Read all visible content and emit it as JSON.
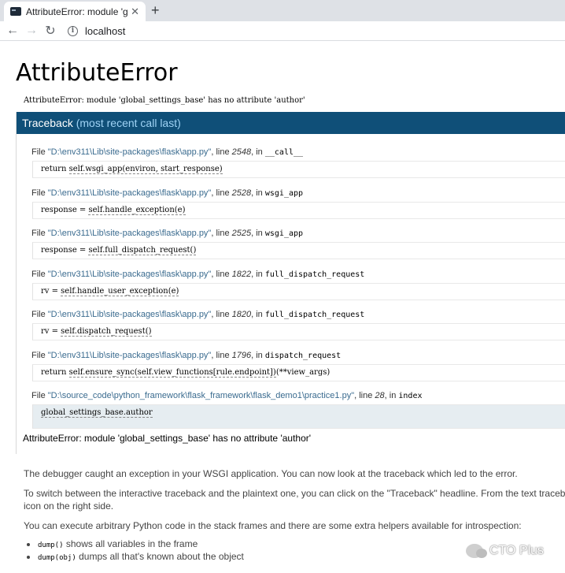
{
  "browser": {
    "tab_title": "AttributeError: module 'global_",
    "tab_close": "✕",
    "new_tab": "+",
    "back": "←",
    "forward": "→",
    "reload": "↻",
    "address": "localhost",
    "info": "i"
  },
  "error": {
    "title": "AttributeError",
    "message": "AttributeError: module 'global_settings_base' has no attribute 'author'"
  },
  "traceback": {
    "header_main": "Traceback",
    "header_sub": "(most recent call last)",
    "frames": [
      {
        "prefix": "File ",
        "file": "\"D:\\env311\\Lib\\site-packages\\flask\\app.py\"",
        "mid": ", line ",
        "line": "2548",
        "in": ", in ",
        "func": "__call__",
        "code_pre": "return ",
        "code_call": "self.wsgi_app(environ, start_response)",
        "code_post": ""
      },
      {
        "prefix": "File ",
        "file": "\"D:\\env311\\Lib\\site-packages\\flask\\app.py\"",
        "mid": ", line ",
        "line": "2528",
        "in": ", in ",
        "func": "wsgi_app",
        "code_pre": "response = ",
        "code_call": "self.handle_exception(e)",
        "code_post": ""
      },
      {
        "prefix": "File ",
        "file": "\"D:\\env311\\Lib\\site-packages\\flask\\app.py\"",
        "mid": ", line ",
        "line": "2525",
        "in": ", in ",
        "func": "wsgi_app",
        "code_pre": "response = ",
        "code_call": "self.full_dispatch_request()",
        "code_post": ""
      },
      {
        "prefix": "File ",
        "file": "\"D:\\env311\\Lib\\site-packages\\flask\\app.py\"",
        "mid": ", line ",
        "line": "1822",
        "in": ", in ",
        "func": "full_dispatch_request",
        "code_pre": "rv = ",
        "code_call": "self.handle_user_exception(e)",
        "code_post": ""
      },
      {
        "prefix": "File ",
        "file": "\"D:\\env311\\Lib\\site-packages\\flask\\app.py\"",
        "mid": ", line ",
        "line": "1820",
        "in": ", in ",
        "func": "full_dispatch_request",
        "code_pre": "rv = ",
        "code_call": "self.dispatch_request()",
        "code_post": ""
      },
      {
        "prefix": "File ",
        "file": "\"D:\\env311\\Lib\\site-packages\\flask\\app.py\"",
        "mid": ", line ",
        "line": "1796",
        "in": ", in ",
        "func": "dispatch_request",
        "code_pre": "return ",
        "code_call": "self.ensure_sync(self.view_functions[rule.endpoint])",
        "code_post": "(**view_args)"
      },
      {
        "prefix": "File ",
        "file": "\"D:\\source_code\\python_framework\\flask_framework\\flask_demo1\\practice1.py\"",
        "mid": ", line ",
        "line": "28",
        "in": ", in ",
        "func": "index",
        "code_pre": "",
        "code_call": "global_settings_base.author",
        "code_post": ""
      }
    ],
    "exception_line": "AttributeError: module 'global_settings_base' has no attribute 'author'"
  },
  "explanation": {
    "p1": "The debugger caught an exception in your WSGI application. You can now look at the traceback which led to the error.",
    "p2": "To switch between the interactive traceback and the plaintext one, you can click on the \"Traceback\" headline. From the text traceback you can also create a paste of it. For code execution mouse-over the frame you want to debug and click on the console icon on the right side.",
    "p2_visible_line1": "To switch between the interactive traceback and the plaintext one, you can click on the \"Traceback\" headline. From the text traceb",
    "p2_visible_line2": "icon on the right side.",
    "p3": "You can execute arbitrary Python code in the stack frames and there are some extra helpers available for introspection:",
    "helpers": [
      {
        "code": "dump()",
        "text": " shows all variables in the frame"
      },
      {
        "code": "dump(obj)",
        "text": " dumps all that's known about the object"
      }
    ]
  },
  "watermark": {
    "text": "CTO Plus"
  }
}
